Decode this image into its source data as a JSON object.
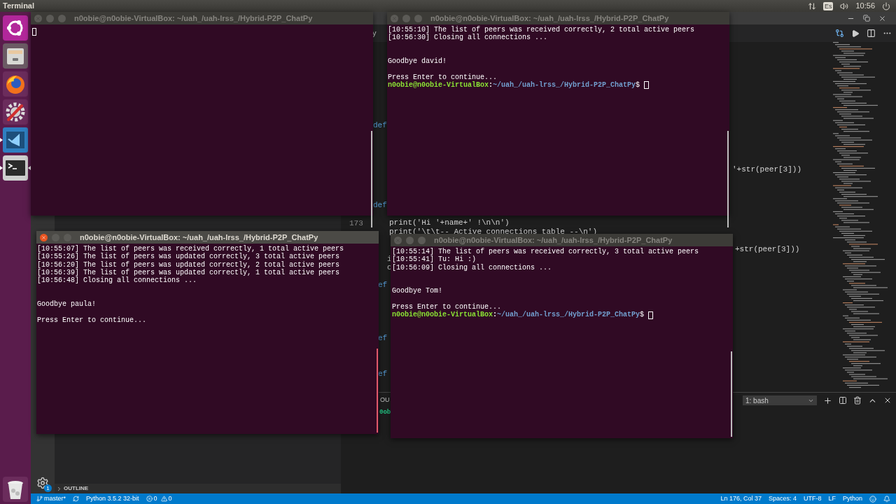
{
  "top_bar": {
    "app_title": "Terminal",
    "keyboard_layout": "Es",
    "clock": "10:56"
  },
  "launcher": [
    {
      "kind": "dash",
      "running": false,
      "focused": false
    },
    {
      "kind": "files",
      "running": false,
      "focused": false
    },
    {
      "kind": "firefox",
      "running": false,
      "focused": false
    },
    {
      "kind": "settings",
      "running": false,
      "focused": false
    },
    {
      "kind": "vscode",
      "running": true,
      "focused": false
    },
    {
      "kind": "terminal",
      "running": true,
      "focused": true
    }
  ],
  "trash": {
    "kind": "trash"
  },
  "editor": {
    "tab_fragment": "y",
    "code": [
      {
        "kind": "keyword",
        "text": "def"
      },
      {
        "kind": "keyword",
        "text": "def"
      },
      {
        "kind": "gutter",
        "text": "173"
      },
      {
        "kind": "code",
        "text": "print('Hi '+name+' !\\n\\n')"
      },
      {
        "kind": "code",
        "text": "print('\\t\\t-- Active connections table --\\n')"
      },
      {
        "kind": "code",
        "text": "i"
      },
      {
        "kind": "code",
        "text": "c"
      },
      {
        "kind": "keyword",
        "text": "ef"
      },
      {
        "kind": "keyword",
        "text": "ef"
      },
      {
        "kind": "keyword",
        "text": "ef"
      },
      {
        "kind": "code",
        "text": "'+str(peer[3]))"
      },
      {
        "kind": "code",
        "text": "+str(peer[3]))"
      }
    ]
  },
  "panel": {
    "tab_fragment": "OU",
    "prompt_fragment": "0ob",
    "terminal_select": "1: bash"
  },
  "sidebar": {
    "outline_label": "OUTLINE",
    "expanded": false
  },
  "activity_bar": {
    "settings_badge": "1"
  },
  "status_bar": {
    "branch": "master*",
    "interpreter": "Python 3.5.2 32-bit",
    "errors": "0",
    "warnings": "0",
    "position": "Ln 176, Col 37",
    "indentation": "Spaces: 4",
    "encoding": "UTF-8",
    "line_ending": "LF",
    "language": "Python"
  },
  "terminals": [
    {
      "title": "n0obie@n0obie-VirtualBox: ~/uah_/uah-lrss_/Hybrid-P2P_ChatPy",
      "active": false,
      "lines": [
        {
          "kind": "cursor"
        }
      ]
    },
    {
      "title": "n0obie@n0obie-VirtualBox: ~/uah_/uah-lrss_/Hybrid-P2P_ChatPy",
      "active": false,
      "lines": [
        {
          "kind": "output",
          "text": "[10:55:10] The list of peers was received correctly, 2 total active peers"
        },
        {
          "kind": "output",
          "text": "[10:56:30] Closing all connections ..."
        },
        {
          "kind": "blank"
        },
        {
          "kind": "blank"
        },
        {
          "kind": "output",
          "text": "Goodbye david!"
        },
        {
          "kind": "blank"
        },
        {
          "kind": "output",
          "text": "Press Enter to continue..."
        },
        {
          "kind": "prompt",
          "user": "n0obie@n0obie-VirtualBox",
          "separator": ":",
          "path": "~/uah_/uah-lrss_/Hybrid-P2P_ChatPy",
          "symbol": "$"
        }
      ]
    },
    {
      "title": "n0obie@n0obie-VirtualBox: ~/uah_/uah-lrss_/Hybrid-P2P_ChatPy",
      "active": true,
      "lines": [
        {
          "kind": "output",
          "text": "[10:55:07] The list of peers was received correctly, 1 total active peers"
        },
        {
          "kind": "output",
          "text": "[10:55:26] The list of peers was updated correctly, 3 total active peers"
        },
        {
          "kind": "output",
          "text": "[10:56:20] The list of peers was updated correctly, 2 total active peers"
        },
        {
          "kind": "output",
          "text": "[10:56:39] The list of peers was updated correctly, 1 total active peers"
        },
        {
          "kind": "output",
          "text": "[10:56:48] Closing all connections ..."
        },
        {
          "kind": "blank"
        },
        {
          "kind": "blank"
        },
        {
          "kind": "output",
          "text": "Goodbye paula!"
        },
        {
          "kind": "blank"
        },
        {
          "kind": "output",
          "text": "Press Enter to continue..."
        }
      ]
    },
    {
      "title": "n0obie@n0obie-VirtualBox: ~/uah_/uah-lrss_/Hybrid-P2P_ChatPy",
      "active": false,
      "lines": [
        {
          "kind": "output",
          "text": "[10:55:14] The list of peers was received correctly, 3 total active peers"
        },
        {
          "kind": "output",
          "text": "[10:55:41] Tu: Hi :)"
        },
        {
          "kind": "output",
          "text": "[10:56:09] Closing all connections ..."
        },
        {
          "kind": "blank"
        },
        {
          "kind": "blank"
        },
        {
          "kind": "output",
          "text": "Goodbye Tom!"
        },
        {
          "kind": "blank"
        },
        {
          "kind": "output",
          "text": "Press Enter to continue..."
        },
        {
          "kind": "prompt",
          "user": "n0obie@n0obie-VirtualBox",
          "separator": ":",
          "path": "~/uah_/uah-lrss_/Hybrid-P2P_ChatPy",
          "symbol": "$"
        }
      ]
    }
  ]
}
